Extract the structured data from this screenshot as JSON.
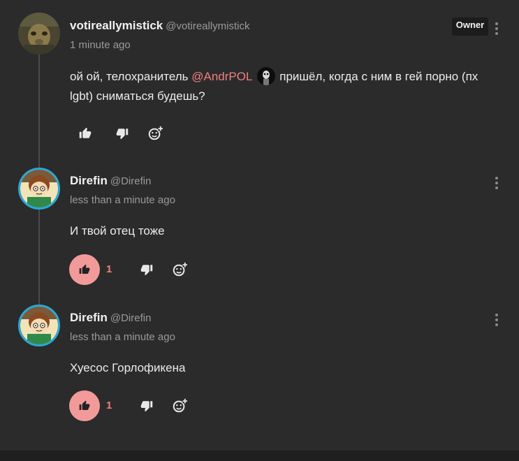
{
  "comments": [
    {
      "username": "votireallymistick",
      "handle": "@votireallymistick",
      "time": "1 minute ago",
      "badge": "Owner",
      "text_before": "ой ой, телохранитель ",
      "mention": "@AndrPOL",
      "text_after": " пришёл, когда с ним в гей порно (пх lgbt) сниматься будешь?",
      "like_active": false,
      "like_count": ""
    },
    {
      "username": "Direfin",
      "handle": "@Direfin",
      "time": "less than a minute ago",
      "text": "И твой отец тоже",
      "like_active": true,
      "like_count": "1"
    },
    {
      "username": "Direfin",
      "handle": "@Direfin",
      "time": "less than a minute ago",
      "text": "Хуесос Горлофикена",
      "like_active": true,
      "like_count": "1"
    }
  ],
  "icons": {
    "like": "thumbs-up-icon",
    "dislike": "thumbs-down-icon",
    "react": "add-reaction-icon",
    "more": "more-vertical-icon"
  },
  "colors": {
    "background": "#2b2b2b",
    "accent": "#f07f7f",
    "like_active_bg": "#f29a9a",
    "avatar_ring": "#29a8d8"
  }
}
